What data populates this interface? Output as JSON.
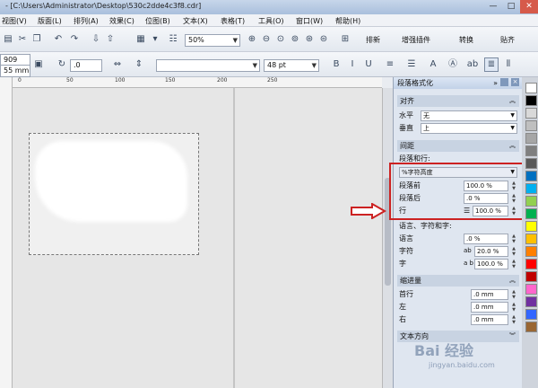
{
  "window": {
    "title": "- [C:\\Users\\Administrator\\Desktop\\530c2dde4c3f8.cdr]",
    "minimize": "—",
    "maximize": "□",
    "close": "✕"
  },
  "menu": [
    "视图(V)",
    "版面(L)",
    "排列(A)",
    "效果(C)",
    "位图(B)",
    "文本(X)",
    "表格(T)",
    "工具(O)",
    "窗口(W)",
    "帮助(H)"
  ],
  "toolbar1": {
    "zoom": "50%",
    "buttons": [
      "排新",
      "增强插件",
      "转换",
      "贴齐"
    ]
  },
  "toolbar2": {
    "width_value": "909 mm",
    "height_value": "55 mm",
    "rotation": ".0",
    "font_name": "",
    "font_size": "48 pt"
  },
  "ruler": [
    "0",
    "50",
    "100",
    "150",
    "200",
    "250"
  ],
  "panel": {
    "title": "段落格式化",
    "alignment": {
      "header": "对齐",
      "horizontal_label": "水平",
      "horizontal_value": "无",
      "vertical_label": "垂直",
      "vertical_value": "上"
    },
    "spacing": {
      "header": "间距",
      "subheader": "段落和行:",
      "mode": "%字符高度",
      "before_label": "段落前",
      "before_value": "100.0 %",
      "after_label": "段落后",
      "after_value": ".0 %",
      "line_label": "行",
      "line_value": "100.0 %"
    },
    "language": {
      "subheader": "语言、字符和字:",
      "language_label": "语言",
      "language_value": ".0 %",
      "char_label": "字符",
      "char_value": "20.0 %",
      "word_label": "字",
      "word_value": "100.0 %"
    },
    "indent": {
      "header": "缩进量",
      "first_label": "首行",
      "first_value": ".0 mm",
      "left_label": "左",
      "left_value": ".0 mm",
      "right_label": "右",
      "right_value": ".0 mm"
    },
    "direction": {
      "header": "文本方向"
    }
  },
  "watermark": {
    "main": "Bai 经验",
    "sub": "jingyan.baidu.com"
  },
  "colors": {
    "highlight": "#cc2222",
    "palette": [
      "#ffffff",
      "#000000",
      "#d9d9d9",
      "#bfbfbf",
      "#a6a6a6",
      "#7f7f7f",
      "#595959",
      "#0070c0",
      "#00b0f0",
      "#92d050",
      "#00b050",
      "#ffff00",
      "#ffc000",
      "#ff7f00",
      "#ff0000",
      "#c00000",
      "#ff66cc",
      "#7030a0",
      "#3366ff",
      "#996633"
    ]
  }
}
